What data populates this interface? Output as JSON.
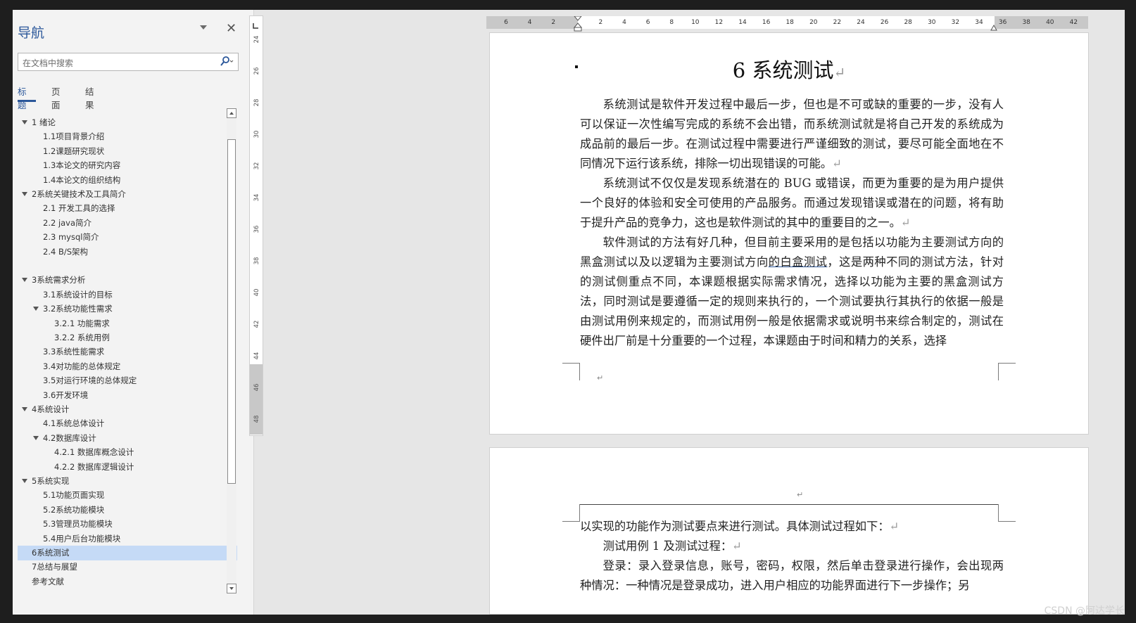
{
  "nav": {
    "title": "导航",
    "search_placeholder": "在文档中搜索",
    "tabs": [
      "标题",
      "页面",
      "结果"
    ],
    "items": [
      {
        "label": "1 绪论",
        "level": 1,
        "toggle": true
      },
      {
        "label": "1.1项目背景介绍",
        "level": 2
      },
      {
        "label": "1.2课题研究现状",
        "level": 2
      },
      {
        "label": "1.3本论文的研究内容",
        "level": 2
      },
      {
        "label": "1.4本论文的组织结构",
        "level": 2
      },
      {
        "label": "2系统关键技术及工具简介",
        "level": 1,
        "toggle": true
      },
      {
        "label": "2.1 开发工具的选择",
        "level": 2
      },
      {
        "label": "2.2 java简介",
        "level": 2
      },
      {
        "label": "2.3 mysql简介",
        "level": 2
      },
      {
        "label": "2.4 B/S架构",
        "level": 2
      },
      {
        "label": "",
        "level": 1
      },
      {
        "label": "3系统需求分析",
        "level": 1,
        "toggle": true
      },
      {
        "label": "3.1系统设计的目标",
        "level": 2
      },
      {
        "label": "3.2系统功能性需求",
        "level": 2,
        "toggle": true
      },
      {
        "label": "3.2.1 功能需求",
        "level": 3
      },
      {
        "label": "3.2.2 系统用例",
        "level": 3
      },
      {
        "label": "3.3系统性能需求",
        "level": 2
      },
      {
        "label": "3.4对功能的总体规定",
        "level": 2
      },
      {
        "label": "3.5对运行环境的总体规定",
        "level": 2
      },
      {
        "label": "3.6开发环境",
        "level": 2
      },
      {
        "label": "4系统设计",
        "level": 1,
        "toggle": true
      },
      {
        "label": "4.1系统总体设计",
        "level": 2
      },
      {
        "label": "4.2数据库设计",
        "level": 2,
        "toggle": true
      },
      {
        "label": "4.2.1 数据库概念设计",
        "level": 3
      },
      {
        "label": "4.2.2 数据库逻辑设计",
        "level": 3
      },
      {
        "label": "5系统实现",
        "level": 1,
        "toggle": true
      },
      {
        "label": "5.1功能页面实现",
        "level": 2
      },
      {
        "label": "5.2系统功能模块",
        "level": 2
      },
      {
        "label": "5.3管理员功能模块",
        "level": 2
      },
      {
        "label": "5.4用户后台功能模块",
        "level": 2
      },
      {
        "label": "6系统测试",
        "level": 1,
        "active": true
      },
      {
        "label": "7总结与展望",
        "level": 1
      },
      {
        "label": "参考文献",
        "level": 1
      }
    ]
  },
  "vruler": {
    "labels": [
      "24",
      "26",
      "28",
      "30",
      "32",
      "34",
      "36",
      "38",
      "40",
      "42",
      "44",
      "46",
      "48"
    ]
  },
  "hruler": {
    "labels": [
      "6",
      "4",
      "2",
      "",
      "2",
      "4",
      "6",
      "8",
      "10",
      "12",
      "14",
      "16",
      "18",
      "20",
      "22",
      "24",
      "26",
      "28",
      "30",
      "32",
      "34",
      "36",
      "38",
      "40",
      "42"
    ]
  },
  "doc": {
    "title": "6 系统测试",
    "p1": "系统测试是软件开发过程中最后一步，但也是不可或缺的重要的一步，没有人可以保证一次性编写完成的系统不会出错，而系统测试就是将自己开发的系统成为成品前的最后一步。在测试过程中需要进行严谨细致的测试，要尽可能全面地在不同情况下运行该系统，排除一切出现错误的可能。",
    "p2": "系统测试不仅仅是发现系统潜在的 BUG 或错误，而更为重要的是为用户提供一个良好的体验和安全可使用的产品服务。而通过发现错误或潜在的问题，将有助于提升产品的竞争力，这也是软件测试的其中的重要目的之一。",
    "p3a": "软件测试的方法有好几种，但目前主要采用的是包括以功能为主要测试方向的黑盒测试以及以逻辑为主要测试方向",
    "p3_link": "的白盒测试",
    "p3b": "，这是两种不同的测试方法，针对的测试侧重点不同，本课题根据实际需求情况，选择以功能为主要的黑盒测试方法，同时测试是要遵循一定的规则来执行的，一个测试要执行其执行的依据一般是由测试用例来规定的，而测试用例一般是依据需求或说明书来综合制定的，测试在硬件出厂前是十分重要的一个过程，本课题由于时间和精力的关系，选择",
    "p4": "以实现的功能作为测试要点来进行测试。具体测试过程如下：",
    "p5": "测试用例 1 及测试过程：",
    "p6": "登录：录入登录信息，账号，密码，权限，然后单击登录进行操作，会出现两种情况：一种情况是登录成功，进入用户相应的功能界面进行下一步操作；另",
    "return_mark": "↵"
  },
  "watermark": "CSDN @阿达学长"
}
